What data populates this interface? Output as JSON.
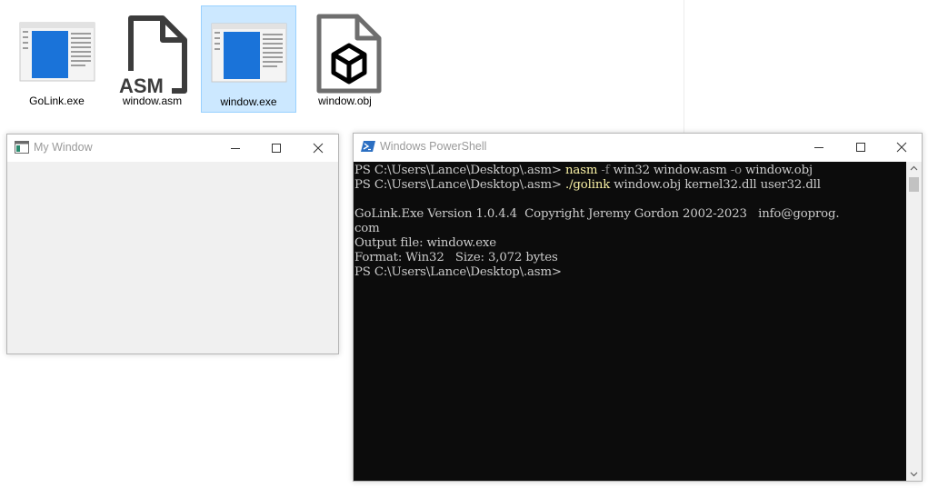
{
  "desktop": {
    "files": [
      {
        "name": "GoLink.exe",
        "icon": "exe-icon",
        "selected": false
      },
      {
        "name": "window.asm",
        "icon": "asm-file-icon",
        "badge": "ASM",
        "selected": false
      },
      {
        "name": "window.exe",
        "icon": "exe-icon",
        "selected": true
      },
      {
        "name": "window.obj",
        "icon": "obj-file-icon",
        "selected": false
      }
    ]
  },
  "my_window": {
    "title": "My Window"
  },
  "powershell": {
    "title": "Windows PowerShell",
    "lines": [
      [
        {
          "t": "PS C:\\Users\\Lance\\Desktop\\.asm> ",
          "c": "text"
        },
        {
          "t": "nasm",
          "c": "cmd"
        },
        {
          "t": " ",
          "c": "text"
        },
        {
          "t": "-f",
          "c": "param"
        },
        {
          "t": " win32 window.asm ",
          "c": "text"
        },
        {
          "t": "-o",
          "c": "param"
        },
        {
          "t": " window.obj",
          "c": "text"
        }
      ],
      [
        {
          "t": "PS C:\\Users\\Lance\\Desktop\\.asm> ",
          "c": "text"
        },
        {
          "t": "./golink",
          "c": "cmd"
        },
        {
          "t": " window.obj kernel32.dll user32.dll",
          "c": "text"
        }
      ],
      [
        {
          "t": "",
          "c": "text"
        }
      ],
      [
        {
          "t": "GoLink.Exe Version 1.0.4.4  Copyright Jeremy Gordon 2002-2023   info@goprog.",
          "c": "text"
        }
      ],
      [
        {
          "t": "com",
          "c": "text"
        }
      ],
      [
        {
          "t": "Output file: window.exe",
          "c": "text"
        }
      ],
      [
        {
          "t": "Format: Win32   Size: 3,072 bytes",
          "c": "text"
        }
      ],
      [
        {
          "t": "PS C:\\Users\\Lance\\Desktop\\.asm>",
          "c": "text"
        }
      ]
    ]
  },
  "colors": {
    "selection_bg": "#cce8ff",
    "console_bg": "#0c0c0c",
    "console_text": "#cccccc",
    "command": "#f9f1a5",
    "parameter": "#8a8a8a",
    "exe_window_blue": "#1a73d9"
  }
}
